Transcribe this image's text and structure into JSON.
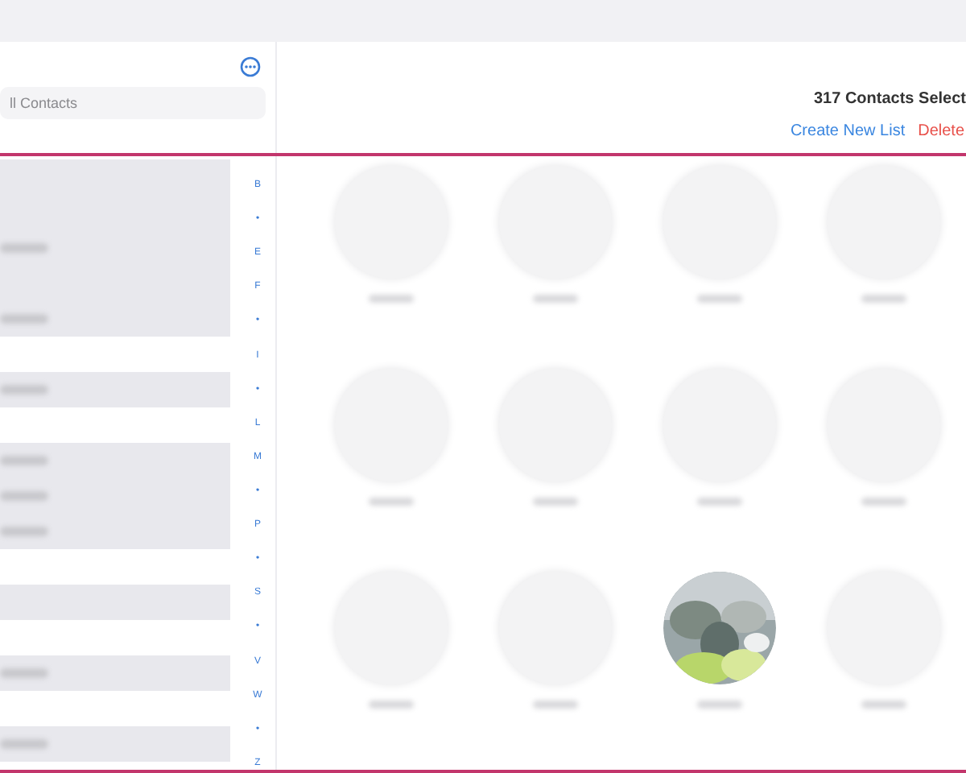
{
  "search": {
    "placeholder": "ll Contacts"
  },
  "list_rows": [
    {
      "kind": "card",
      "blurred_text": false
    },
    {
      "kind": "card",
      "blurred_text": false
    },
    {
      "kind": "card",
      "blurred_text": true
    },
    {
      "kind": "card",
      "blurred_text": false
    },
    {
      "kind": "card",
      "blurred_text": true
    },
    {
      "kind": "blank",
      "blurred_text": false
    },
    {
      "kind": "card",
      "blurred_text": true
    },
    {
      "kind": "blank",
      "blurred_text": false
    },
    {
      "kind": "card",
      "blurred_text": true
    },
    {
      "kind": "card",
      "blurred_text": true
    },
    {
      "kind": "card",
      "blurred_text": true
    },
    {
      "kind": "blank",
      "blurred_text": false
    },
    {
      "kind": "card",
      "blurred_text": false
    },
    {
      "kind": "blank",
      "blurred_text": false
    },
    {
      "kind": "card",
      "blurred_text": true
    },
    {
      "kind": "blank",
      "blurred_text": false
    },
    {
      "kind": "card",
      "blurred_text": true
    }
  ],
  "index": [
    "B",
    "•",
    "E",
    "F",
    "•",
    "I",
    "•",
    "L",
    "M",
    "•",
    "P",
    "•",
    "S",
    "•",
    "V",
    "W",
    "•",
    "Z"
  ],
  "header": {
    "count": "317 Contacts Select",
    "actions": [
      {
        "label": "Create New List",
        "kind": "primary"
      },
      {
        "label": "Delete",
        "kind": "danger"
      }
    ]
  },
  "contacts": [
    {
      "kind": "placeholder"
    },
    {
      "kind": "placeholder"
    },
    {
      "kind": "placeholder"
    },
    {
      "kind": "placeholder"
    },
    {
      "kind": "placeholder"
    },
    {
      "kind": "placeholder"
    },
    {
      "kind": "placeholder"
    },
    {
      "kind": "placeholder"
    },
    {
      "kind": "placeholder"
    },
    {
      "kind": "placeholder"
    },
    {
      "kind": "picture"
    },
    {
      "kind": "placeholder"
    }
  ]
}
